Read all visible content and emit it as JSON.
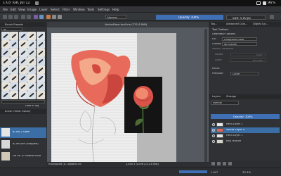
{
  "status_bar": {
    "time": "1:03",
    "date": "Tue, Jul 12",
    "battery": "96%"
  },
  "menu": [
    "File",
    "Edit",
    "View",
    "Image",
    "Layer",
    "Select",
    "Filter",
    "Window",
    "Tools",
    "Settings",
    "Help"
  ],
  "toolbar": {
    "brush_mode": "Normal",
    "opacity": "Opacity: 100%",
    "size": "Size: 5.00 px"
  },
  "left_panel": {
    "brush_presets_title": "Brush Presets",
    "tag_label": "All",
    "filter_label": "Filter in Tag",
    "history_title": "Brush Preset History",
    "history": [
      "d) Ink-2 Open",
      "d) Ink pen (stopped)",
      "DA 06 10 Palette Knife"
    ]
  },
  "document_title": "VectorRose-bud.kra (231.8 MiB)",
  "canvas_status": {
    "left": "RGB/Alpha (8...eglibtrc.icc",
    "size": "3,600 x 4,096 (231.8 MiB)",
    "zoom": "33.3%"
  },
  "right_panel": {
    "tabs": [
      "Too...",
      "Advanced Colo...",
      "Digital Col..."
    ],
    "tool_options_title": "Tool Options",
    "geometry_label": "Geometry Options",
    "fill_label": "Fill:",
    "fill_value": "Foreground color",
    "outline_label": "Outline:",
    "outline_value": "No Outline",
    "pattern_label": "Pattern Transform",
    "rotate_label": "Rotate:",
    "rotate_value": "0.00°",
    "scale_label": "Scale:",
    "scale_value": "100.00%",
    "pencil_label": "Pencil",
    "precision_label": "Precision:",
    "precision_value": "Curve",
    "layers_tabs": [
      "Layers",
      "Storage"
    ],
    "blend_mode": "Normal",
    "opacity_label": "Opacity: 100%",
    "layers": [
      "Paint Layer 2",
      "Vector Layer 4",
      "Paint Layer 1",
      "Bkg Texture"
    ],
    "bottom_readout": "1.54°",
    "zoom": "33.3%"
  }
}
